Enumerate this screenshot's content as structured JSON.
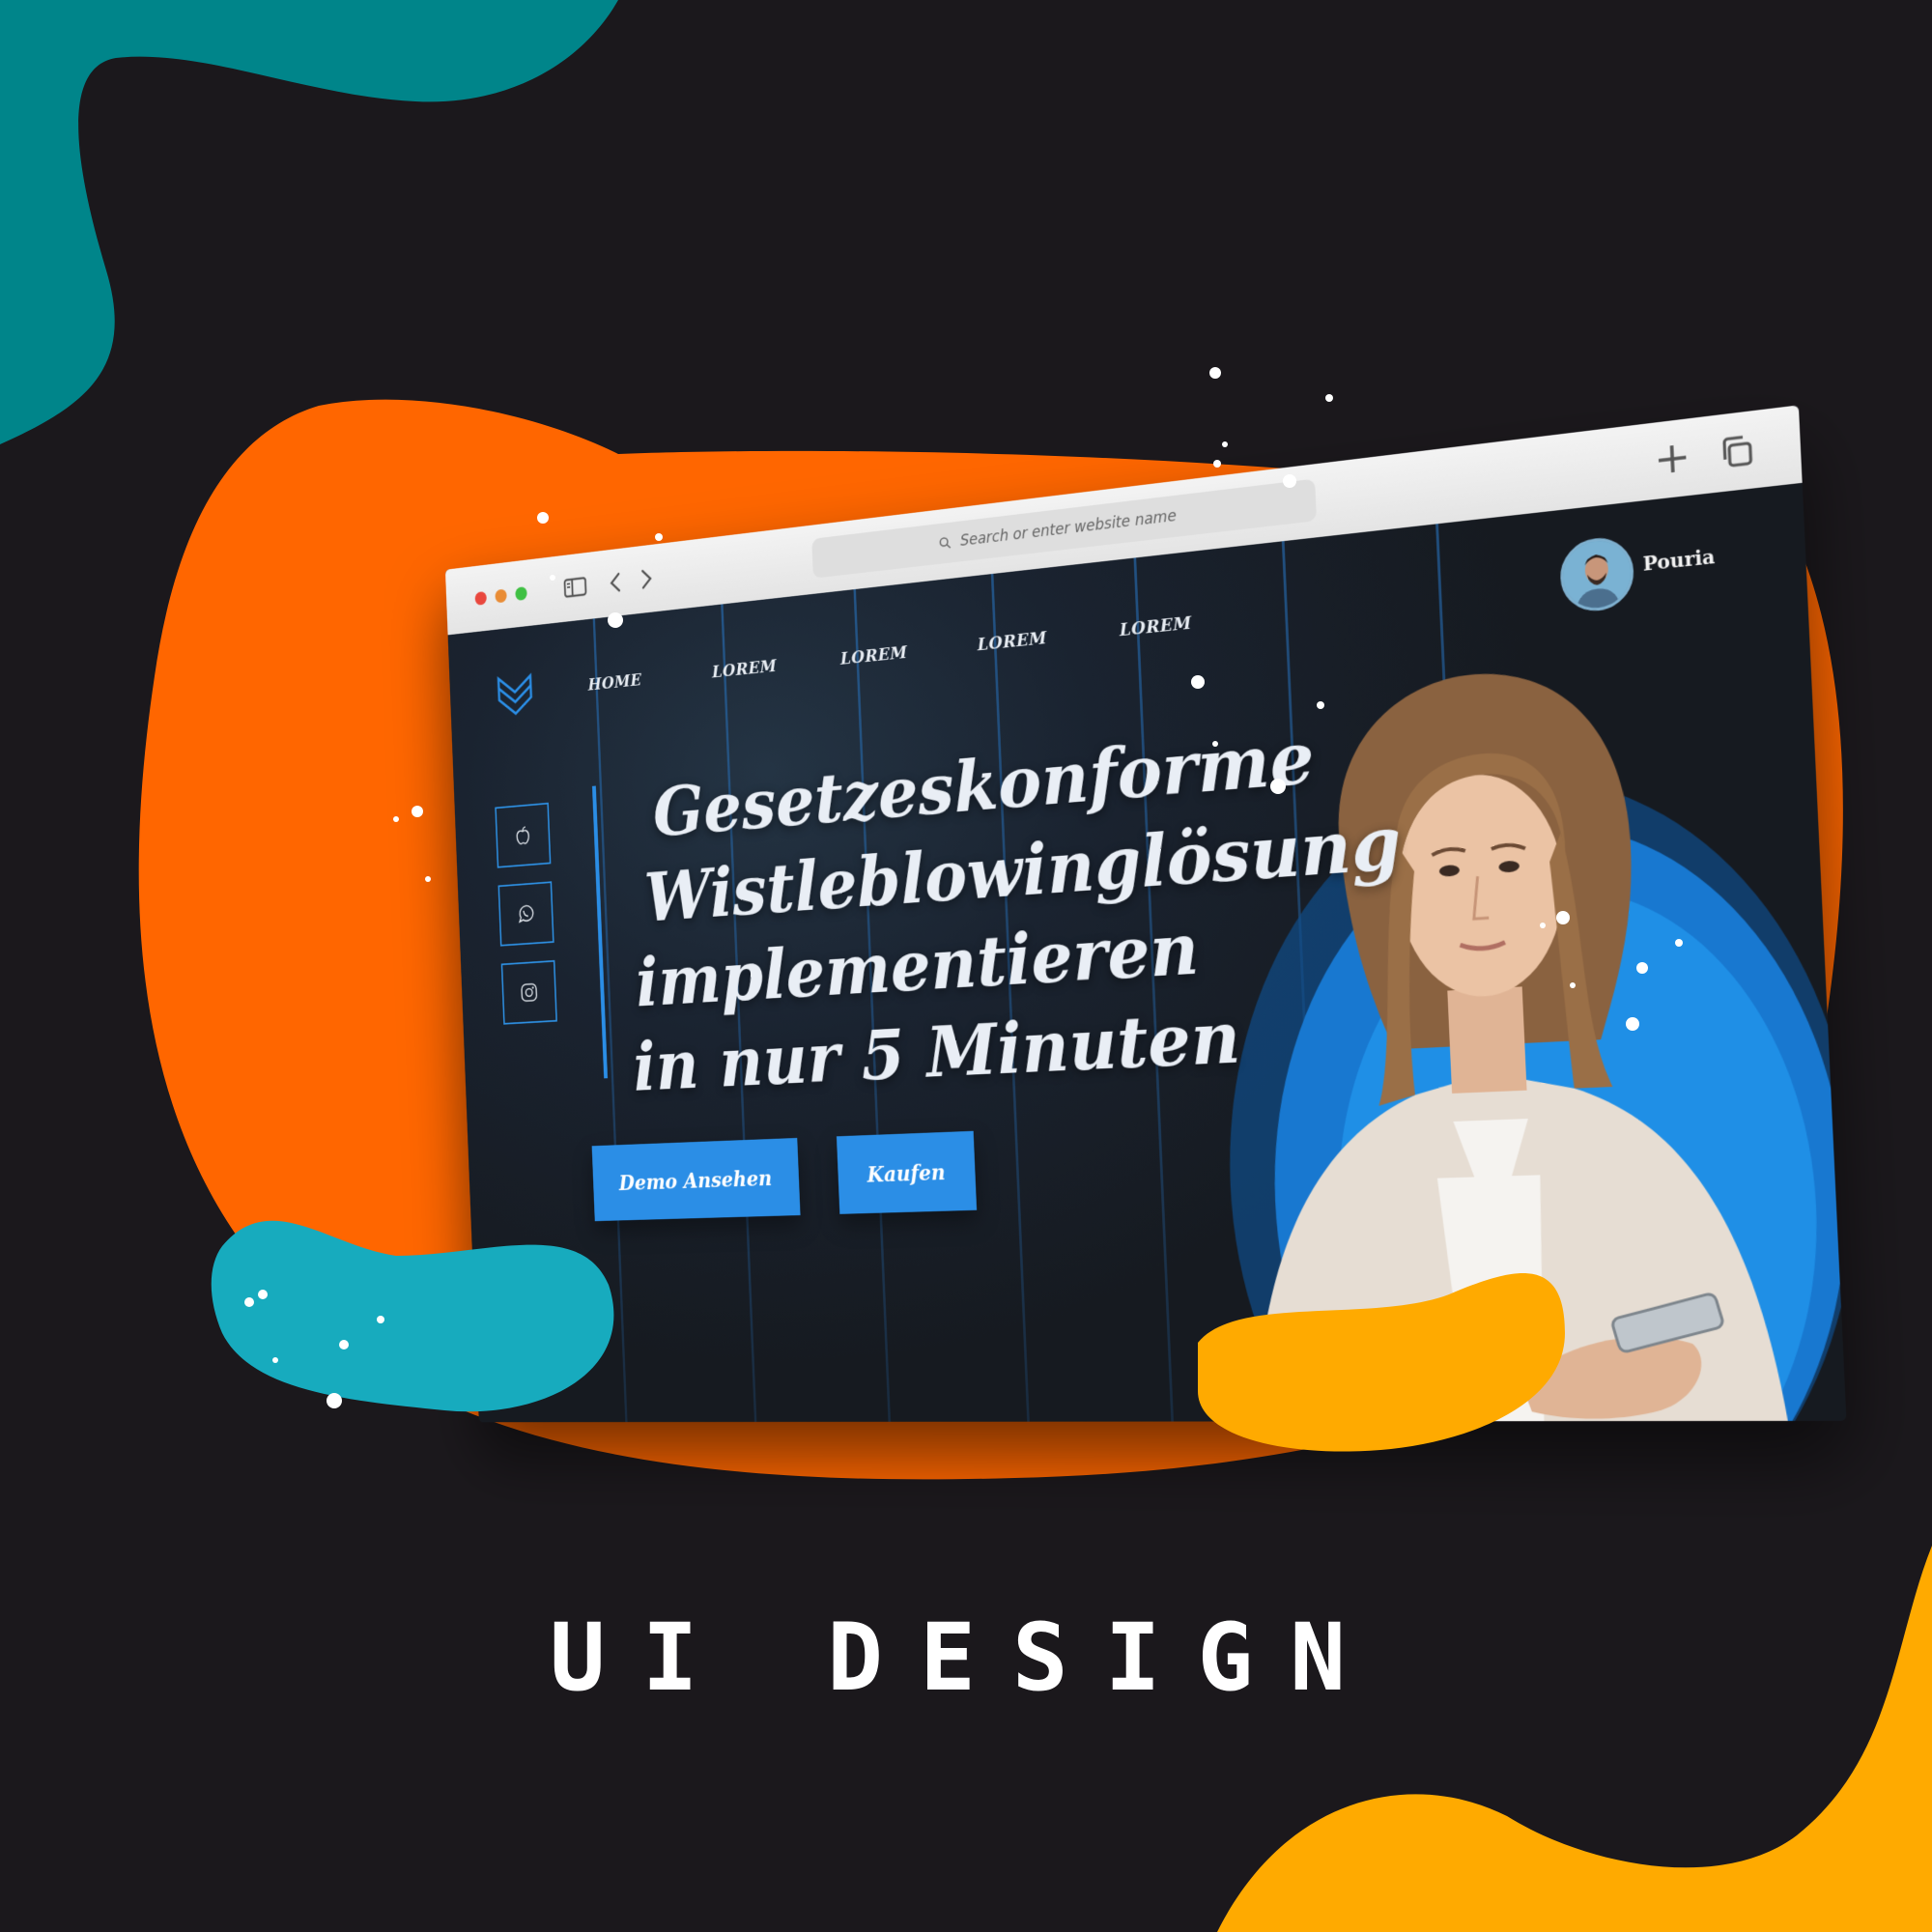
{
  "browser": {
    "url_placeholder": "Search or enter website name"
  },
  "site": {
    "nav": [
      "HOME",
      "LOREM",
      "LOREM",
      "LOREM",
      "LOREM"
    ],
    "user_name": "Pouria",
    "headline": [
      "Gesetzeskonforme",
      "Wistleblowinglösung",
      "implementieren",
      "in nur 5 Minuten"
    ],
    "demo_button": "Demo Ansehen",
    "buy_button": "Kaufen",
    "social_icons": [
      "apple-icon",
      "whatsapp-icon",
      "instagram-icon"
    ]
  },
  "caption": "UI DESIGN",
  "colors": {
    "background": "#1b181c",
    "accent_blue": "#2b8ee6",
    "orange": "#ff6600",
    "teal": "#00858a",
    "cyan": "#17abbe",
    "amber": "#ffaa00"
  }
}
